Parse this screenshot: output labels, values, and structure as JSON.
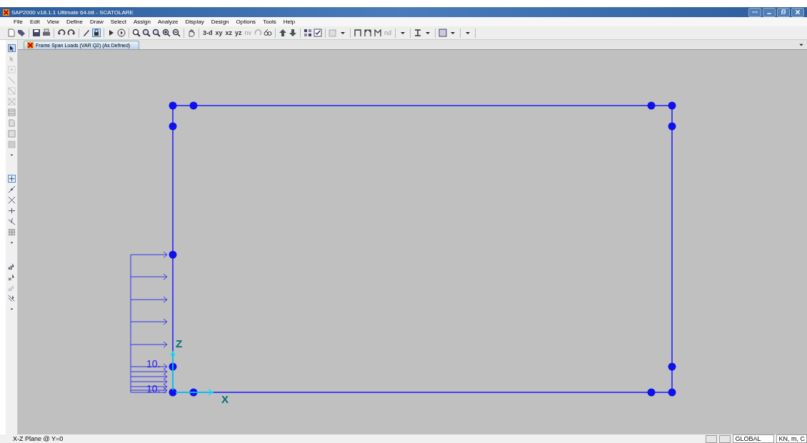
{
  "window": {
    "title": "SAP2000 v18.1.1 Ultimate 64-bit - SCATOLARE"
  },
  "menu": [
    "File",
    "Edit",
    "View",
    "Define",
    "Draw",
    "Select",
    "Assign",
    "Analyze",
    "Display",
    "Design",
    "Options",
    "Tools",
    "Help"
  ],
  "toolbar": {
    "view_buttons": [
      "3-d",
      "xy",
      "xz",
      "yz",
      "nv"
    ],
    "snap_label": "nd"
  },
  "tabs": [
    {
      "label": "Frame Span Loads (VAR Q2) (As Defined)",
      "selected": true
    }
  ],
  "drawing": {
    "load_labels": [
      "10.",
      "10."
    ],
    "axes": [
      "X",
      "Z"
    ]
  },
  "status_bar": {
    "text": "X-Z Plane @ Y=0",
    "coordinate_system": "GLOBAL",
    "units": "KN, m, C"
  }
}
